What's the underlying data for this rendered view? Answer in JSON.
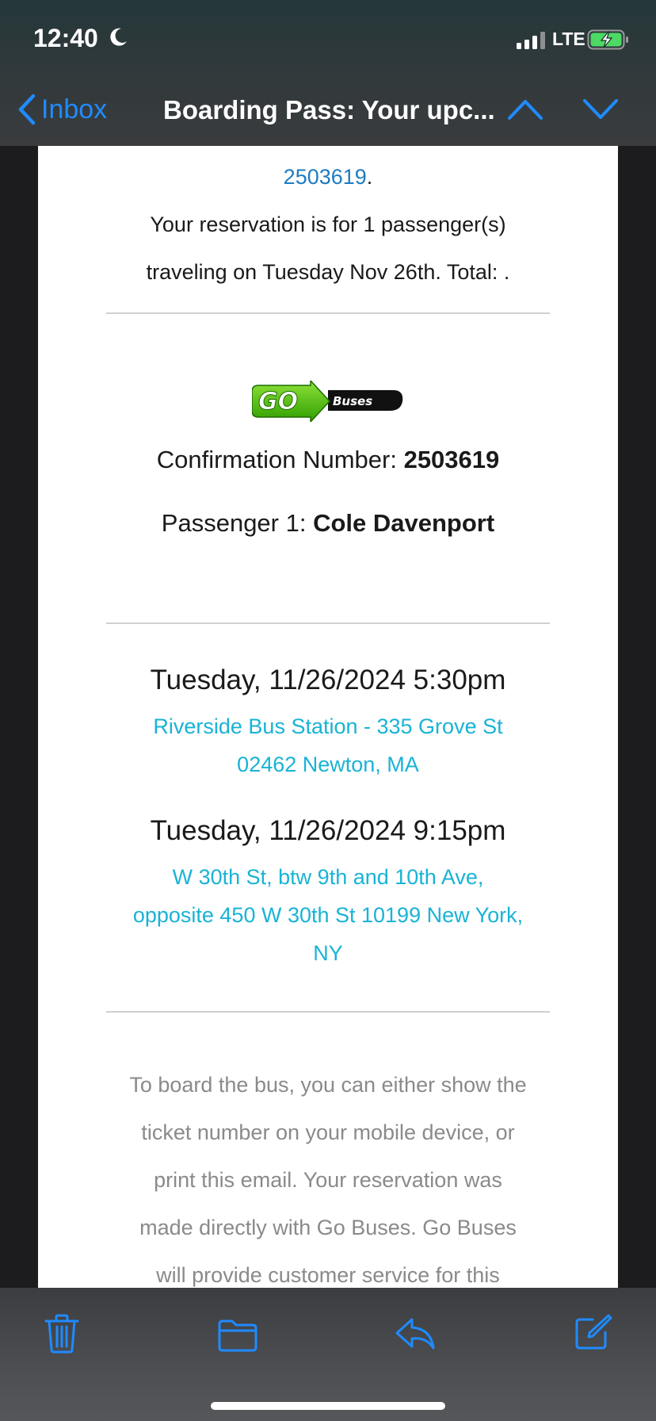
{
  "status": {
    "time": "12:40",
    "network": "LTE",
    "icons": [
      "moon-icon",
      "signal-icon",
      "battery-charging-icon"
    ]
  },
  "nav": {
    "back_label": "Inbox",
    "title": "Boarding Pass: Your upc..."
  },
  "email": {
    "conf_link": "2503619",
    "conf_link_suffix": ".",
    "reservation_line1": "Your reservation is for 1 passenger(s)",
    "reservation_line2": "traveling on Tuesday Nov 26th. Total: .",
    "logo_text": "GO",
    "logo_sub": "Buses",
    "confirmation_label": "Confirmation Number: ",
    "confirmation_number": "2503619",
    "passenger_label": "Passenger 1: ",
    "passenger_name": "Cole Davenport",
    "departure": {
      "datetime": "Tuesday, 11/26/2024 5:30pm",
      "address_line1": "Riverside Bus Station - 335 Grove St",
      "address_line2": "02462 Newton, MA"
    },
    "arrival": {
      "datetime": "Tuesday, 11/26/2024 9:15pm",
      "address_line1": "W 30th St, btw 9th and 10th Ave,",
      "address_line2": "opposite 450 W 30th St 10199 New York,",
      "address_line3": "NY"
    },
    "info_lines": [
      "To board the bus, you can either show the",
      "ticket number on your mobile device, or",
      "print this email. Your reservation was",
      "made directly with Go Buses. Go Buses",
      "will provide customer service for this"
    ]
  },
  "toolbar": {
    "items": [
      "trash-icon",
      "folder-icon",
      "reply-icon",
      "compose-icon"
    ]
  },
  "colors": {
    "accent": "#1f8bff",
    "link_blue": "#1e7cc1",
    "address_cyan": "#19b3d6",
    "logo_green": "#3fb800"
  }
}
